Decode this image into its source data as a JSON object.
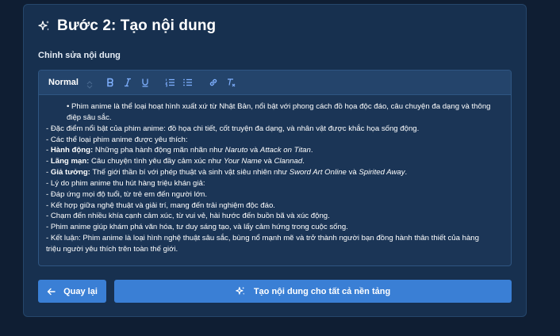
{
  "step": {
    "title": "Bước 2: Tạo nội dung",
    "icon": "sparkles-icon"
  },
  "editor": {
    "label": "Chỉnh sửa nội dung",
    "toolbar": {
      "format_select": "Normal",
      "buttons": [
        "bold-icon",
        "italic-icon",
        "underline-icon",
        "ordered-list-icon",
        "bullet-list-icon",
        "link-icon",
        "clear-format-icon"
      ]
    },
    "content": {
      "intro_bullet": "Phim anime là thể loại hoạt hình xuất xứ từ Nhật Bản, nổi bật với phong cách đồ họa độc đáo, câu chuyện đa dạng và thông điệp sâu sắc.",
      "l1": "- Đặc điểm nổi bật của phim anime: đồ họa chi tiết, cốt truyện đa dạng, và nhân vật được khắc họa sống động.",
      "l2": "- Các thể loại phim anime được yêu thích:",
      "l3_label": "Hành động:",
      "l3_text": " Những pha hành động mãn nhãn như ",
      "l3_i1": "Naruto",
      "l3_mid": " và ",
      "l3_i2": "Attack on Titan",
      "l3_end": ".",
      "l4_label": "Lãng mạn:",
      "l4_text": " Câu chuyện tình yêu đầy cảm xúc như ",
      "l4_i1": "Your Name",
      "l4_mid": " và ",
      "l4_i2": "Clannad",
      "l4_end": ".",
      "l5_label": "Giả tưởng:",
      "l5_text": " Thế giới thần bí với phép thuật và sinh vật siêu nhiên như ",
      "l5_i1": "Sword Art Online",
      "l5_mid": " và ",
      "l5_i2": "Spirited Away",
      "l5_end": ".",
      "l6": "- Lý do phim anime thu hút hàng triệu khán giả:",
      "l7": "- Đáp ứng mọi độ tuổi, từ trẻ em đến người lớn.",
      "l8": "- Kết hợp giữa nghệ thuật và giải trí, mang đến trải nghiệm độc đáo.",
      "l9": "- Chạm đến nhiều khía cạnh cảm xúc, từ vui vẻ, hài hước đến buồn bã và xúc động.",
      "l10": "- Phim anime giúp khám phá văn hóa, tư duy sáng tạo, và lấy cảm hứng trong cuộc sống.",
      "l11a": "- Kết luận: Phim anime là loại hình nghệ thuật sâu sắc, bùng nổ mạnh mẽ và trở thành người bạn đồng hành thân thiết của hàng",
      "l11b": "triệu người yêu thích trên toàn thế giới."
    }
  },
  "actions": {
    "back_label": "Quay lại",
    "generate_label": "Tạo nội dung cho tất cả nền tảng"
  },
  "colors": {
    "background": "#0f1e33",
    "card": "#17304f",
    "accent": "#3a7fd5",
    "toolbar": "#24446b"
  }
}
